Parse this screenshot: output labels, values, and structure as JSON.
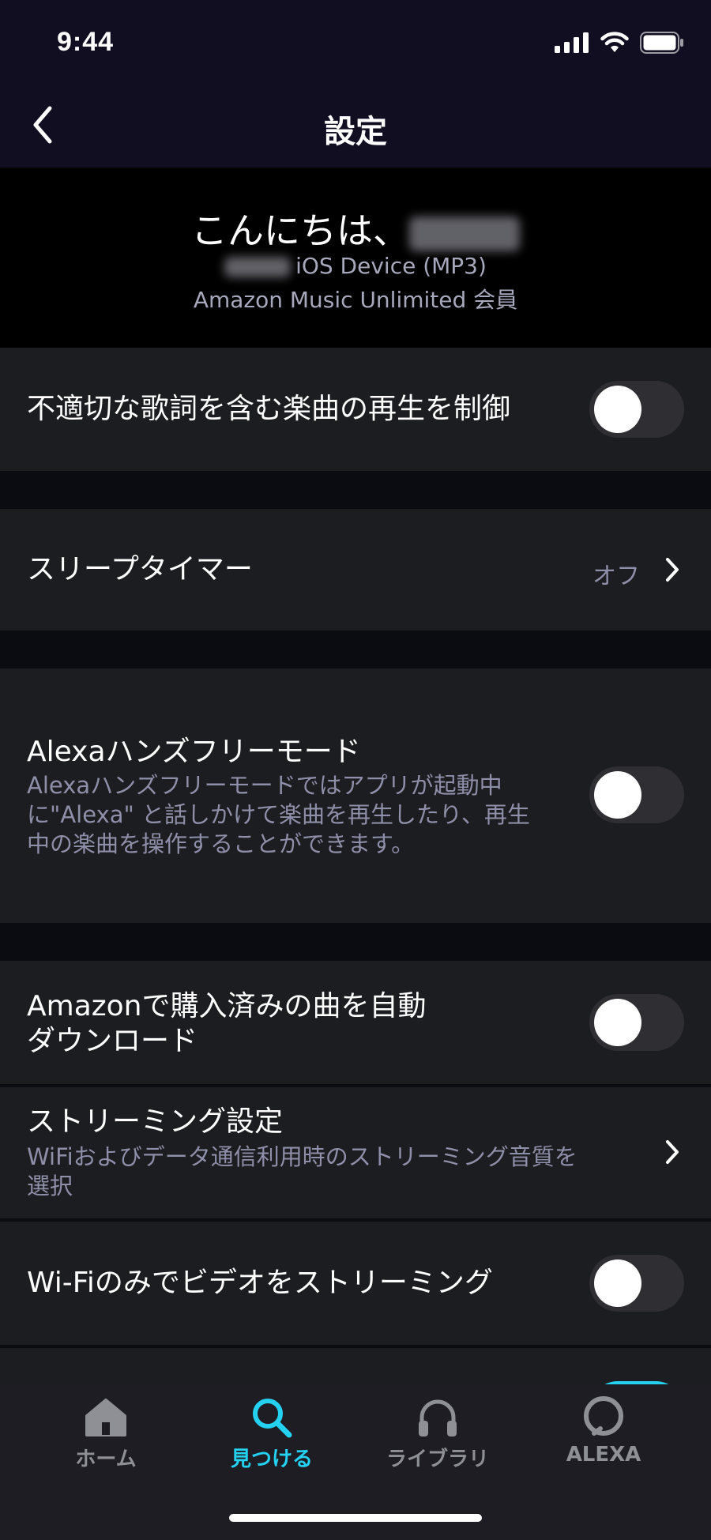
{
  "status_bar": {
    "time": "9:44"
  },
  "nav": {
    "title": "設定"
  },
  "greeting": {
    "hello": "こんにちは、",
    "device": "iOS Device (MP3)",
    "membership": "Amazon Music Unlimited 会員"
  },
  "settings": {
    "explicit": {
      "title": "不適切な歌詞を含む楽曲の再生を制御",
      "enabled": false
    },
    "sleep_timer": {
      "title": "スリープタイマー",
      "value": "オフ"
    },
    "alexa_handsfree": {
      "title": "Alexaハンズフリーモード",
      "desc_line1": "Alexaハンズフリーモードではアプリが起動中",
      "desc_line2": "に\"Alexa\" と話しかけて楽曲を再生したり、再生",
      "desc_line3": "中の楽曲を操作することができます。",
      "enabled": false
    },
    "auto_download": {
      "title_line1": "Amazonで購入済みの曲を自動",
      "title_line2": "ダウンロード",
      "enabled": false
    },
    "streaming": {
      "title": "ストリーミング設定",
      "desc_line1": "WiFiおよびデータ通信利用時のストリーミング音質を",
      "desc_line2": "選択"
    },
    "wifi_video": {
      "title": "Wi-Fiのみでビデオをストリーミング",
      "enabled": false
    }
  },
  "tabs": [
    {
      "label": "ホーム",
      "icon": "home-icon",
      "active": false
    },
    {
      "label": "見つける",
      "icon": "search-icon",
      "active": true
    },
    {
      "label": "ライブラリ",
      "icon": "headphones-icon",
      "active": false
    },
    {
      "label": "ALEXA",
      "icon": "alexa-icon",
      "active": false
    }
  ],
  "colors": {
    "accent": "#25d1f0",
    "background": "#0b0b12",
    "row": "#1c1d20"
  }
}
